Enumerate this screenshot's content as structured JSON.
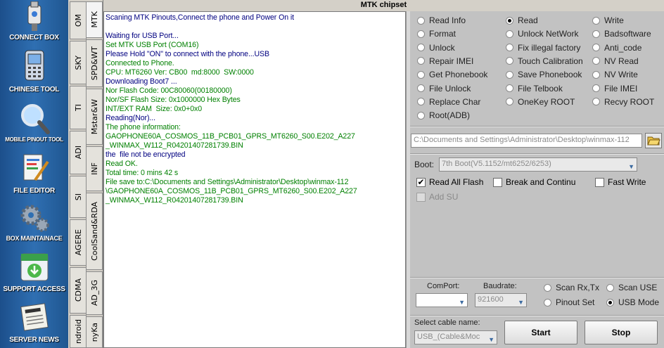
{
  "window_title": "MTK chipset",
  "sidebar": [
    {
      "label": "CONNECT BOX",
      "icon": "usb-connect-box-icon"
    },
    {
      "label": "CHINESE TOOL",
      "icon": "chinese-phone-icon"
    },
    {
      "label": "MOBILE PINOUT TOOL",
      "icon": "magnifier-icon"
    },
    {
      "label": "FILE EDITOR",
      "icon": "file-editor-icon"
    },
    {
      "label": "BOX MAINTAINACE",
      "icon": "gears-icon"
    },
    {
      "label": "SUPPORT ACCESS",
      "icon": "support-download-icon"
    },
    {
      "label": "SERVER NEWS",
      "icon": "newspaper-icon"
    }
  ],
  "outer_tabs": [
    "OM",
    "SKY",
    "TI",
    "ADI",
    "SI",
    "AGERE",
    "CDMA",
    "ndroid"
  ],
  "inner_tabs": [
    "MTK",
    "SPD&WT",
    "Mstar&W",
    "INF",
    "CoolSand&RDA",
    "AD_3G",
    "nyKa"
  ],
  "log": [
    {
      "text": "Scaning MTK Pinouts,Connect the phone and Power On it",
      "color": "#000080"
    },
    {
      "text": "",
      "color": "#000080"
    },
    {
      "text": "Waiting for USB Port...",
      "color": "#000080"
    },
    {
      "text": "Set MTK USB Port (COM16)",
      "color": "#008000"
    },
    {
      "text": "Please Hold \"ON\" to connect with the phone...USB",
      "color": "#000080"
    },
    {
      "text": "Connected to Phone.",
      "color": "#008000"
    },
    {
      "text": "CPU: MT6260 Ver: CB00  md:8000  SW:0000",
      "color": "#008000"
    },
    {
      "text": "Downloading Boot7 ...",
      "color": "#000080"
    },
    {
      "text": "Nor Flash Code: 00C80060(00180000)",
      "color": "#008000"
    },
    {
      "text": "Nor/SF Flash Size: 0x1000000 Hex Bytes",
      "color": "#008000"
    },
    {
      "text": "INT/EXT RAM  Size: 0x0+0x0",
      "color": "#008000"
    },
    {
      "text": "Reading(Nor)...",
      "color": "#000080"
    },
    {
      "text": "The phone information:",
      "color": "#008000"
    },
    {
      "text": "GAOPHONE60A_COSMOS_11B_PCB01_GPRS_MT6260_S00.E202_A227",
      "color": "#008000"
    },
    {
      "text": "_WINMAX_W112_R04201407281739.BIN",
      "color": "#008000"
    },
    {
      "text": "the  file not be encrypted",
      "color": "#000080"
    },
    {
      "text": "Read OK.",
      "color": "#008000"
    },
    {
      "text": "Total time: 0 mins 42 s",
      "color": "#008000"
    },
    {
      "text": "File save to:C:\\Documents and Settings\\Administrator\\Desktop\\winmax-112",
      "color": "#008000"
    },
    {
      "text": "\\GAOPHONE60A_COSMOS_11B_PCB01_GPRS_MT6260_S00.E202_A227",
      "color": "#008000"
    },
    {
      "text": "_WINMAX_W112_R04201407281739.BIN",
      "color": "#008000"
    }
  ],
  "operations": {
    "col1": [
      "Read Info",
      "Format",
      "Unlock",
      "Repair IMEI",
      "Get Phonebook",
      "File Unlock",
      "Replace Char",
      "Root(ADB)"
    ],
    "col2": [
      "Read",
      "Unlock NetWork",
      "Fix illegal factory",
      "Touch Calibration",
      "Save Phonebook",
      "File Telbook",
      "OneKey ROOT"
    ],
    "col3": [
      "Write",
      "Badsoftware",
      "Anti_code",
      "NV  Read",
      "NV  Write",
      "File IMEI",
      "Recvy ROOT"
    ],
    "selected": "Read"
  },
  "file_path": "C:\\Documents and Settings\\Administrator\\Desktop\\winmax-112",
  "boot": {
    "label": "Boot:",
    "value": "7th Boot(V5.1152/mt6252/6253)"
  },
  "options": {
    "read_all_flash": {
      "label": "Read All Flash",
      "checked": true
    },
    "break_and_continue": {
      "label": "Break and Continu",
      "checked": false
    },
    "fast_write": {
      "label": "Fast Write",
      "checked": false
    },
    "add_su": {
      "label": "Add SU",
      "checked": false
    }
  },
  "comport": {
    "label": "ComPort:",
    "value": ""
  },
  "baudrate": {
    "label": "Baudrate:",
    "value": "921600"
  },
  "scan": {
    "rx_tx": "Scan Rx,Tx",
    "use": "Scan USE",
    "pinout_set": "Pinout Set",
    "usb_mode": "USB Mode",
    "selected": "USB Mode"
  },
  "cable": {
    "label": "Select cable name:",
    "value": "USB_(Cable&Moc"
  },
  "buttons": {
    "start": "Start",
    "stop": "Stop"
  }
}
